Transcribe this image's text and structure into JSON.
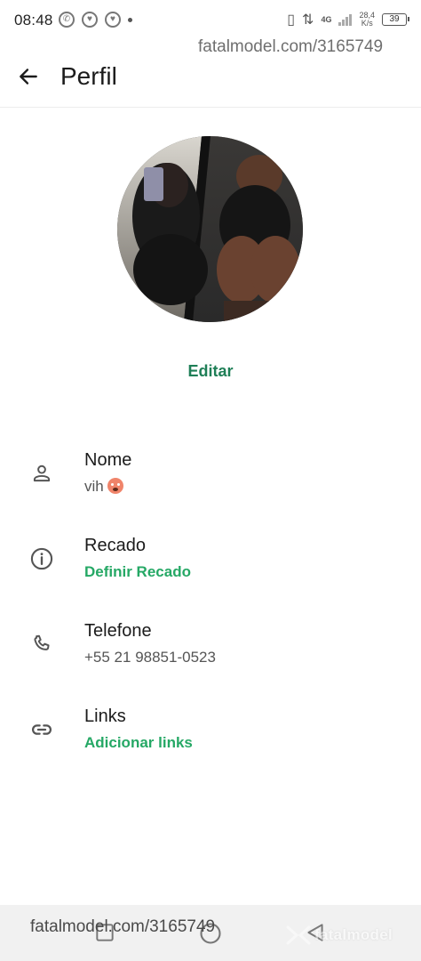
{
  "status_bar": {
    "time": "08:48",
    "network": "4G",
    "speed_top": "28,4",
    "speed_bottom": "K/s",
    "battery": "39"
  },
  "watermark": {
    "top": "fatalmodel.com/3165749",
    "bottom": "fatalmodel.com/3165749",
    "logo": "fatalmodel"
  },
  "header": {
    "title": "Perfil"
  },
  "profile": {
    "edit_label": "Editar"
  },
  "fields": [
    {
      "label": "Nome",
      "value": "vih",
      "icon": "person-icon"
    },
    {
      "label": "Recado",
      "value": "Definir Recado",
      "icon": "info-icon"
    },
    {
      "label": "Telefone",
      "value": "+55 21 98851-0523",
      "icon": "phone-icon"
    },
    {
      "label": "Links",
      "value": "Adicionar links",
      "icon": "link-icon"
    }
  ],
  "colors": {
    "accent_green": "#25a865",
    "edit_green": "#1f7f57"
  }
}
